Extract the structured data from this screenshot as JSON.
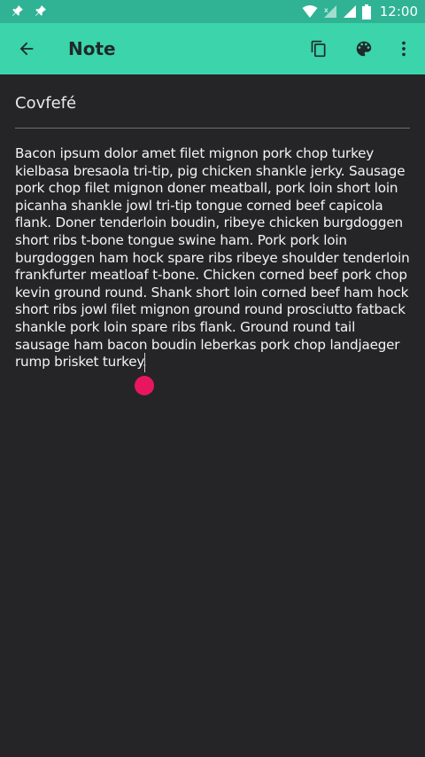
{
  "status_bar": {
    "time": "12:00",
    "icons": [
      "pin-icon",
      "pin-icon",
      "wifi-icon",
      "signal-no-data-icon",
      "signal-icon",
      "battery-icon"
    ]
  },
  "app_bar": {
    "title": "Note",
    "back_icon": "arrow-back-icon",
    "actions": [
      "copy-icon",
      "palette-icon",
      "more-vert-icon"
    ],
    "color": "#3cd4aa"
  },
  "note": {
    "title": "Covfefé",
    "body": "Bacon ipsum dolor amet filet mignon pork chop turkey kielbasa bresaola tri-tip, pig chicken shankle jerky. Sausage pork chop filet mignon doner meatball, pork loin short loin picanha shankle jowl tri-tip tongue corned beef capicola flank. Doner tenderloin boudin, ribeye chicken burgdoggen short ribs t-bone tongue swine ham. Pork pork loin burgdoggen ham hock spare ribs ribeye shoulder tenderloin frankfurter meatloaf t-bone. Chicken corned beef pork chop kevin ground round. Shank short loin corned beef ham hock short ribs jowl filet mignon ground round prosciutto fatback shankle pork loin spare ribs flank. Ground round tail sausage ham bacon boudin leberkas pork chop landjaeger rump brisket turkey."
  },
  "colors": {
    "status_bar": "#2fb394",
    "background": "#252528",
    "cursor_handle": "#e8175d"
  }
}
